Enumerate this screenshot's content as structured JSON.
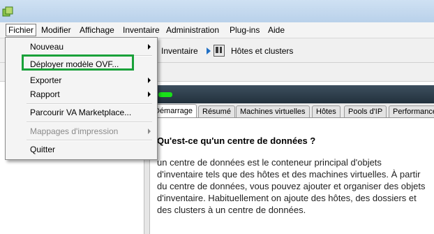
{
  "menubar": {
    "items": [
      "Fichier",
      "Modifier",
      "Affichage",
      "Inventaire",
      "Administration",
      "Plug-ins",
      "Aide"
    ]
  },
  "breadcrumb": {
    "inventory": "Inventaire",
    "hosts_clusters": "Hôtes et clusters"
  },
  "file_menu": {
    "items": [
      {
        "label": "Nouveau",
        "has_submenu": true,
        "enabled": true
      },
      {
        "label": "Déployer modèle OVF...",
        "has_submenu": false,
        "enabled": true,
        "highlighted": true
      },
      {
        "label": "Exporter",
        "has_submenu": true,
        "enabled": true
      },
      {
        "label": "Rapport",
        "has_submenu": true,
        "enabled": true
      },
      {
        "label": "Parcourir VA Marketplace...",
        "has_submenu": false,
        "enabled": true
      },
      {
        "label": "Mappages d'impression",
        "has_submenu": true,
        "enabled": false
      },
      {
        "label": "Quitter",
        "has_submenu": false,
        "enabled": true
      }
    ]
  },
  "tabs": [
    "Démarrage",
    "Résumé",
    "Machines virtuelles",
    "Hôtes",
    "Pools d'IP",
    "Performance"
  ],
  "content": {
    "heading": "Qu'est-ce qu'un centre de données ?",
    "paragraph": "un centre de données est le conteneur principal d'objets d'inventaire tels que des hôtes et des machines virtuelles. À partir du centre de données, vous pouvez ajouter et organiser des objets d'inventaire. Habituellement on ajoute des hôtes, des dossiers et des clusters à un centre de données."
  },
  "colors": {
    "highlight": "#1aa13a",
    "status": "#19e019",
    "header_bg": "#2d3d4a"
  }
}
